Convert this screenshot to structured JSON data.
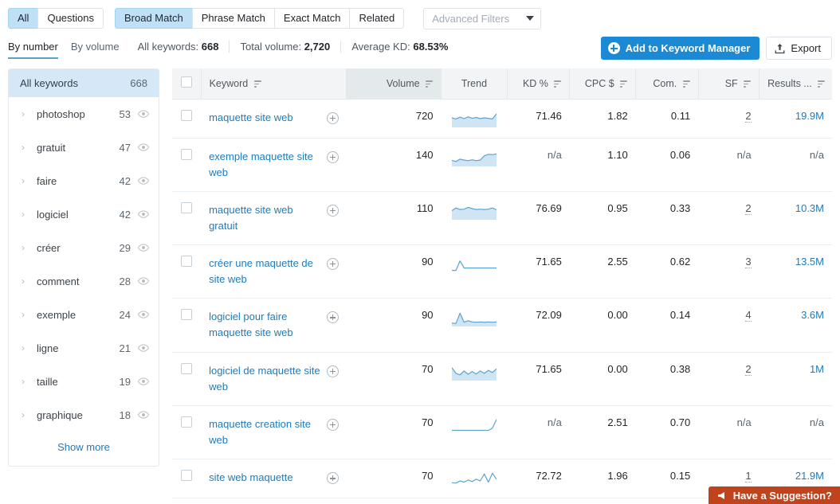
{
  "filters": {
    "match_groups": [
      {
        "label": "All",
        "active": true
      },
      {
        "label": "Questions",
        "active": false
      }
    ],
    "match_types": [
      {
        "label": "Broad Match",
        "active": true
      },
      {
        "label": "Phrase Match",
        "active": false
      },
      {
        "label": "Exact Match",
        "active": false
      },
      {
        "label": "Related",
        "active": false
      }
    ],
    "advanced": {
      "label": "Advanced Filters",
      "icon": "chevron-down-icon"
    }
  },
  "view_toggle": [
    {
      "label": "By number",
      "active": true
    },
    {
      "label": "By volume",
      "active": false
    }
  ],
  "stats": [
    {
      "label": "All keywords:",
      "value": "668"
    },
    {
      "label": "Total volume:",
      "value": "2,720"
    },
    {
      "label": "Average KD:",
      "value": "68.53%"
    }
  ],
  "actions": {
    "add_to_manager": {
      "label": "Add to Keyword Manager",
      "icon": "plus-circle-icon",
      "color": "#1c89d4"
    },
    "export": {
      "label": "Export",
      "icon": "export-upload-icon"
    }
  },
  "sidebar": {
    "all": {
      "label": "All keywords",
      "count": "668"
    },
    "items": [
      {
        "label": "photoshop",
        "count": "53",
        "icon": "eye-icon",
        "caret": "chevron-right-icon"
      },
      {
        "label": "gratuit",
        "count": "47",
        "icon": "eye-icon",
        "caret": "chevron-right-icon"
      },
      {
        "label": "faire",
        "count": "42",
        "icon": "eye-icon",
        "caret": "chevron-right-icon"
      },
      {
        "label": "logiciel",
        "count": "42",
        "icon": "eye-icon",
        "caret": "chevron-right-icon"
      },
      {
        "label": "créer",
        "count": "29",
        "icon": "eye-icon",
        "caret": "chevron-right-icon"
      },
      {
        "label": "comment",
        "count": "28",
        "icon": "eye-icon",
        "caret": "chevron-right-icon"
      },
      {
        "label": "exemple",
        "count": "24",
        "icon": "eye-icon",
        "caret": "chevron-right-icon"
      },
      {
        "label": "ligne",
        "count": "21",
        "icon": "eye-icon",
        "caret": "chevron-right-icon"
      },
      {
        "label": "taille",
        "count": "19",
        "icon": "eye-icon",
        "caret": "chevron-right-icon"
      },
      {
        "label": "graphique",
        "count": "18",
        "icon": "eye-icon",
        "caret": "chevron-right-icon"
      }
    ],
    "show_more": "Show more"
  },
  "table": {
    "columns": [
      {
        "key": "check",
        "label": "",
        "sortable": false,
        "sorted": false
      },
      {
        "key": "keyword",
        "label": "Keyword",
        "sortable": true,
        "sorted": false
      },
      {
        "key": "volume",
        "label": "Volume",
        "sortable": true,
        "sorted": true
      },
      {
        "key": "trend",
        "label": "Trend",
        "sortable": false,
        "sorted": false
      },
      {
        "key": "kd",
        "label": "KD %",
        "sortable": true,
        "sorted": false
      },
      {
        "key": "cpc",
        "label": "CPC $",
        "sortable": true,
        "sorted": false
      },
      {
        "key": "com",
        "label": "Com.",
        "sortable": true,
        "sorted": false
      },
      {
        "key": "sf",
        "label": "SF",
        "sortable": true,
        "sorted": false
      },
      {
        "key": "results",
        "label": "Results ...",
        "sortable": true,
        "sorted": false
      }
    ],
    "rows": [
      {
        "keyword": "maquette site web",
        "volume": "720",
        "kd": "71.46",
        "cpc": "1.82",
        "com": "0.11",
        "sf": "2",
        "results": "19.9M",
        "trend": [
          0.55,
          0.48,
          0.6,
          0.5,
          0.62,
          0.52,
          0.58,
          0.5,
          0.55,
          0.52,
          0.48,
          0.82
        ],
        "trend_filled": true
      },
      {
        "keyword": "exemple maquette site web",
        "volume": "140",
        "kd": "n/a",
        "cpc": "1.10",
        "com": "0.06",
        "sf": "n/a",
        "results": "n/a",
        "trend": [
          0.32,
          0.25,
          0.4,
          0.34,
          0.3,
          0.36,
          0.3,
          0.34,
          0.62,
          0.72,
          0.7,
          0.74
        ],
        "trend_filled": true
      },
      {
        "keyword": "maquette site web gratuit",
        "volume": "110",
        "kd": "76.69",
        "cpc": "0.95",
        "com": "0.33",
        "sf": "2",
        "results": "10.3M",
        "trend": [
          0.52,
          0.7,
          0.6,
          0.62,
          0.74,
          0.66,
          0.6,
          0.62,
          0.6,
          0.62,
          0.7,
          0.58
        ],
        "trend_filled": true
      },
      {
        "keyword": "créer une maquette de site web",
        "volume": "90",
        "kd": "71.65",
        "cpc": "2.55",
        "com": "0.62",
        "sf": "3",
        "results": "13.5M",
        "trend": [
          0.1,
          0.1,
          0.72,
          0.26,
          0.26,
          0.26,
          0.26,
          0.26,
          0.26,
          0.26,
          0.26,
          0.26
        ],
        "trend_filled": false
      },
      {
        "keyword": "logiciel pour faire maquette site web",
        "volume": "90",
        "kd": "72.09",
        "cpc": "0.00",
        "com": "0.14",
        "sf": "4",
        "results": "3.6M",
        "trend": [
          0.14,
          0.12,
          0.8,
          0.2,
          0.3,
          0.22,
          0.2,
          0.22,
          0.2,
          0.22,
          0.2,
          0.22
        ],
        "trend_filled": true
      },
      {
        "keyword": "logiciel de maquette site web",
        "volume": "70",
        "kd": "71.65",
        "cpc": "0.00",
        "com": "0.38",
        "sf": "2",
        "results": "1M",
        "trend": [
          0.78,
          0.4,
          0.3,
          0.56,
          0.34,
          0.52,
          0.36,
          0.56,
          0.4,
          0.6,
          0.46,
          0.7
        ],
        "trend_filled": true
      },
      {
        "keyword": "maquette creation site web",
        "volume": "70",
        "kd": "n/a",
        "cpc": "2.51",
        "com": "0.70",
        "sf": "n/a",
        "results": "n/a",
        "trend": [
          0.16,
          0.16,
          0.16,
          0.16,
          0.16,
          0.16,
          0.16,
          0.16,
          0.16,
          0.16,
          0.3,
          0.88
        ],
        "trend_filled": false
      },
      {
        "keyword": "site web maquette",
        "volume": "70",
        "kd": "72.72",
        "cpc": "1.96",
        "com": "0.15",
        "sf": "1",
        "results": "21.9M",
        "trend": [
          0.22,
          0.2,
          0.34,
          0.26,
          0.4,
          0.3,
          0.46,
          0.34,
          0.8,
          0.26,
          0.86,
          0.44
        ],
        "trend_filled": false
      }
    ]
  },
  "suggestion_badge": {
    "label": "Have a Suggestion?",
    "icon": "megaphone-icon",
    "color": "#c0431c"
  }
}
